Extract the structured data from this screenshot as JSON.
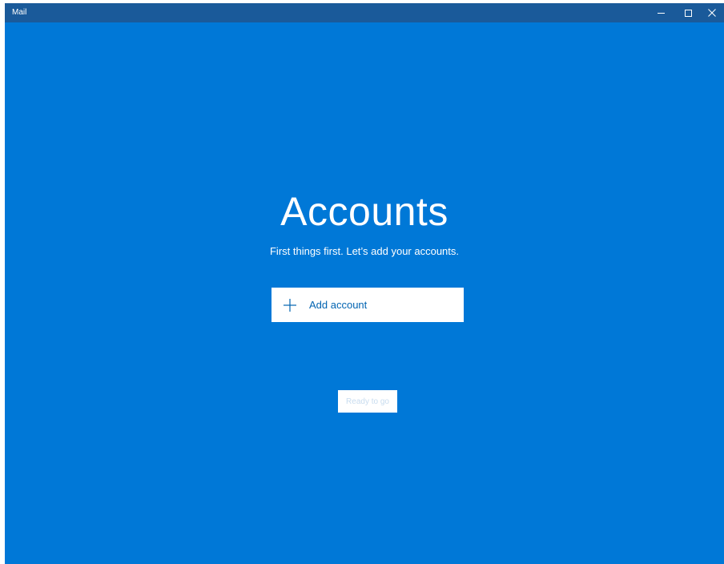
{
  "window": {
    "title": "Mail",
    "controls": {
      "minimize": "minimize-icon",
      "maximize": "maximize-icon",
      "close": "close-icon"
    }
  },
  "main": {
    "heading": "Accounts",
    "subtitle": "First things first. Let’s add your accounts.",
    "add_account_label": "Add account",
    "ready_label": "Ready to go"
  },
  "colors": {
    "background": "#0078d7",
    "titlebar": "#1a5a9a",
    "button_text": "#0063b1"
  }
}
